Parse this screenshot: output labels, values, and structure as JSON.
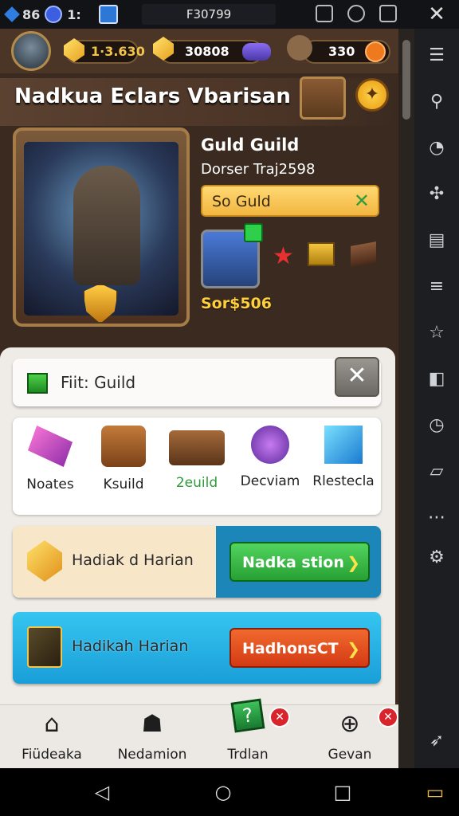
{
  "emulator": {
    "left_count": "86",
    "left_code": "1:",
    "window_title": "F30799"
  },
  "resources": {
    "gold": "1·3.630",
    "gems": "30808",
    "energy": "330"
  },
  "header": {
    "title": "Nadkua Eclars Vbarisan"
  },
  "guild_info": {
    "title": "Guld Guild",
    "subtitle": "Dorser Traj2598",
    "action_label": "So Guld",
    "score": "Sor$506"
  },
  "dialog": {
    "title": "Fiit: Guild",
    "categories": [
      {
        "label": "Noates",
        "icon": "gem-icon"
      },
      {
        "label": "Ksuild",
        "icon": "backpack-icon"
      },
      {
        "label": "2euild",
        "icon": "book-icon"
      },
      {
        "label": "Decviam",
        "icon": "orb-icon"
      },
      {
        "label": "Rlestecla",
        "icon": "ice-cube-icon"
      }
    ],
    "rows": [
      {
        "label": "Hadiak d Harian",
        "button": "Nadka stion",
        "icon": "amber-gem-icon"
      },
      {
        "label": "Hadikah Harian",
        "button": "HadhonsCT",
        "icon": "sword-icon"
      }
    ]
  },
  "bottom_nav": [
    {
      "label": "Fiüdeaka",
      "icon": "house-icon"
    },
    {
      "label": "Nedamion",
      "icon": "helmet-icon"
    },
    {
      "label": "Trdlan",
      "icon": "trade-icon"
    },
    {
      "label": "Gevan",
      "icon": "plus-circle-icon"
    }
  ],
  "colors": {
    "accent_green": "#27a034",
    "accent_orange": "#d43a14",
    "accent_blue": "#1a9ed8",
    "gold": "#ffcf3c"
  }
}
